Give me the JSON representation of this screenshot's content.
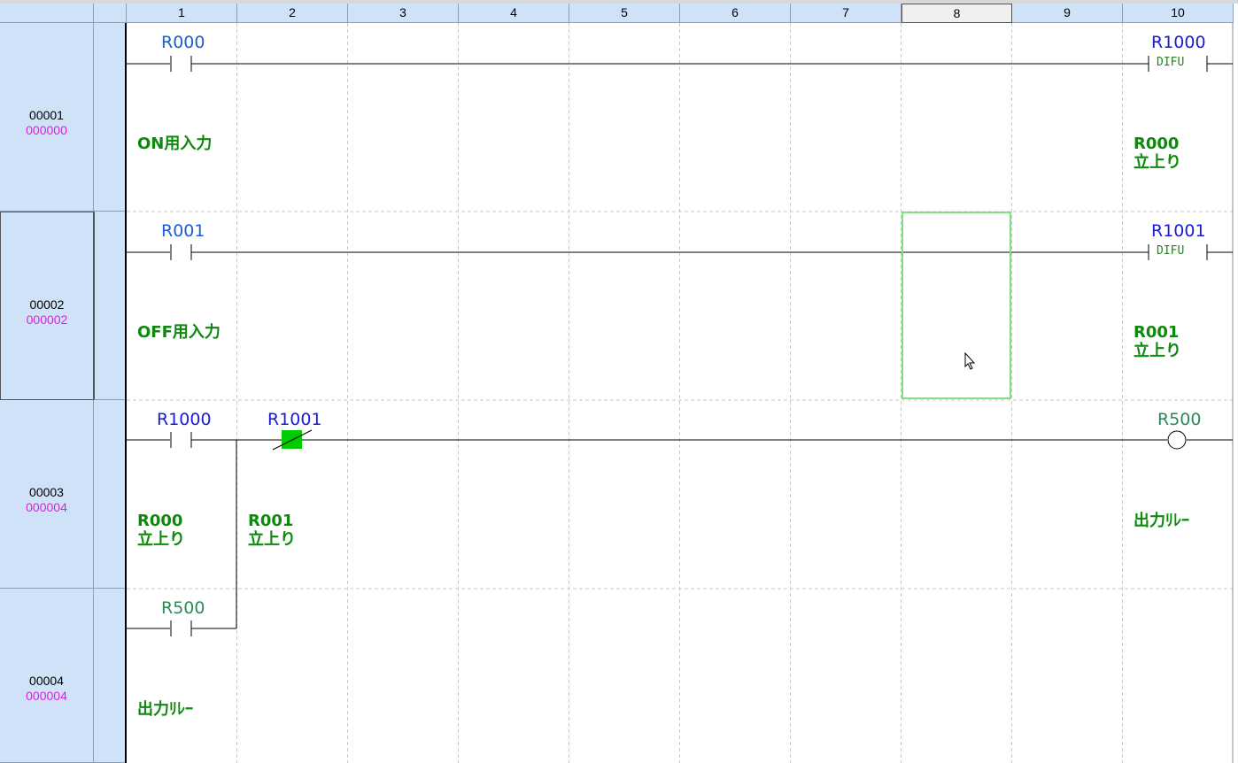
{
  "columns": [
    "1",
    "2",
    "3",
    "4",
    "5",
    "6",
    "7",
    "8",
    "9",
    "10"
  ],
  "rows": [
    {
      "num": "00001",
      "step": "000000"
    },
    {
      "num": "00002",
      "step": "000002"
    },
    {
      "num": "00003",
      "step": "000004"
    },
    {
      "num": "00004",
      "step": "000004"
    }
  ],
  "rungs": {
    "r1": {
      "contact": "R000",
      "contact_comment": "ON用入力",
      "coil": "R1000",
      "coil_fn": "DIFU",
      "coil_comment_1": "R000",
      "coil_comment_2": "立上り"
    },
    "r2": {
      "contact": "R001",
      "contact_comment": "OFF用入力",
      "coil": "R1001",
      "coil_fn": "DIFU",
      "coil_comment_1": "R001",
      "coil_comment_2": "立上り"
    },
    "r3": {
      "contact_a": "R1000",
      "contact_a_comment_1": "R000",
      "contact_a_comment_2": "立上り",
      "contact_b": "R1001",
      "contact_b_comment_1": "R001",
      "contact_b_comment_2": "立上り",
      "coil": "R500",
      "coil_comment": "出力ﾘﾚｰ"
    },
    "r4": {
      "contact": "R500",
      "contact_comment": "出力ﾘﾚｰ"
    }
  },
  "colors": {
    "header_bg": "#cfe2f8",
    "step_color": "#e020e0",
    "comment_color": "#0d8a0d",
    "cursor_color": "#7fe07f",
    "highlight_fill": "#00cc00"
  },
  "selected_column": "8",
  "selected_row": "00002"
}
